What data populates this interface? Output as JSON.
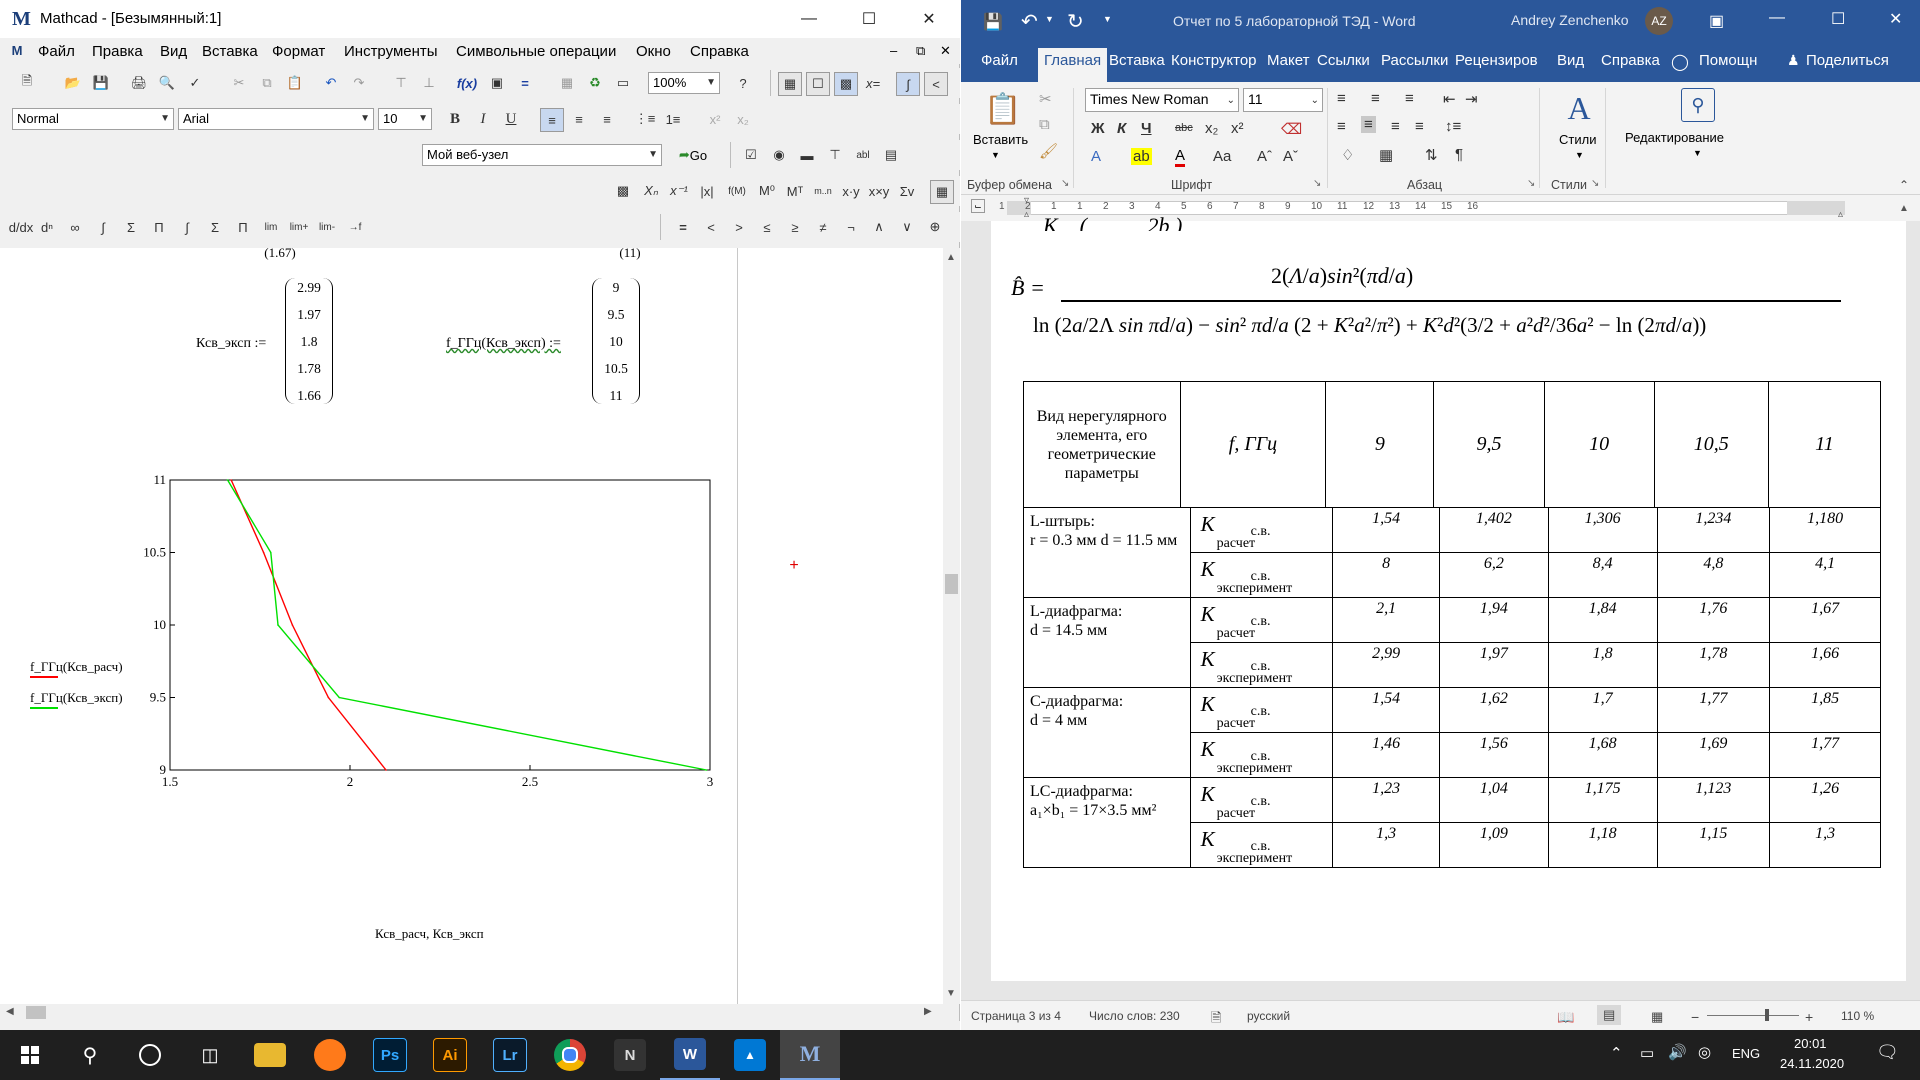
{
  "mathcad": {
    "title": "Mathcad - [Безымянный:1]",
    "menu": [
      "Файл",
      "Правка",
      "Вид",
      "Вставка",
      "Формат",
      "Инструменты",
      "Символьные операции",
      "Окно",
      "Справка"
    ],
    "zoom": "100%",
    "style_combo": "Normal",
    "font_combo": "Arial",
    "size_combo": "10",
    "url_combo": "Мой веб-узел",
    "go_label": "Go",
    "partial_top_left": "1.67",
    "partial_top_right": "11",
    "left_def_label": "Ксв_эксп :=",
    "right_def_label": "f_ГГц(Ксв_эксп) :=",
    "left_matrix": [
      "2.99",
      "1.97",
      "1.8",
      "1.78",
      "1.66"
    ],
    "right_matrix": [
      "9",
      "9.5",
      "10",
      "10.5",
      "11"
    ],
    "legend": [
      {
        "label": "f_ГГц(Ксв_расч)",
        "color": "#ff0000"
      },
      {
        "label": "f_ГГц(Ксв_эксп)",
        "color": "#00e000"
      }
    ],
    "x_axis_label": "Ксв_расч, Ксв_эксп"
  },
  "chart_data": {
    "type": "line",
    "title": "",
    "xlabel": "Ксв_расч, Ксв_эксп",
    "ylabel": "",
    "xlim": [
      1.5,
      3
    ],
    "ylim": [
      9,
      11
    ],
    "x_ticks": [
      "1.5",
      "2",
      "2.5",
      "3"
    ],
    "y_ticks": [
      "9",
      "9.5",
      "10",
      "10.5",
      "11"
    ],
    "series": [
      {
        "name": "f_ГГц(Ксв_расч)",
        "color": "#ff0000",
        "x": [
          2.1,
          1.94,
          1.84,
          1.76,
          1.67
        ],
        "y": [
          9,
          9.5,
          10,
          10.5,
          11
        ]
      },
      {
        "name": "f_ГГц(Ксв_эксп)",
        "color": "#00e000",
        "x": [
          2.99,
          1.97,
          1.8,
          1.78,
          1.66
        ],
        "y": [
          9,
          9.5,
          10,
          10.5,
          11
        ]
      }
    ]
  },
  "word": {
    "title": "Отчет по 5 лабораторной ТЭД - Word",
    "user": "Andrey Zenchenko",
    "tabs": [
      "Файл",
      "Главная",
      "Вставка",
      "Конструктор",
      "Макет",
      "Ссылки",
      "Рассылки",
      "Рецензиров",
      "Вид",
      "Справка",
      "Помощн",
      "Поделиться"
    ],
    "font_name": "Times New Roman",
    "font_size": "11",
    "paste_label": "Вставить",
    "styles_label": "Стили",
    "editing_label": "Редактирование",
    "groups": [
      "Буфер обмена",
      "Шрифт",
      "Абзац",
      "Стили"
    ],
    "ruler_numbers": [
      "1",
      "2",
      "1",
      "1",
      "2",
      "3",
      "4",
      "5",
      "6",
      "7",
      "8",
      "9",
      "10",
      "11",
      "12",
      "13",
      "14",
      "15",
      "16"
    ],
    "table": {
      "header": [
        "Вид нерегулярного элемента, его геометрические параметры",
        "f, ГГц",
        "9",
        "9,5",
        "10",
        "10,5",
        "11"
      ],
      "row_sub_calc": "с.в.",
      "row_calc_label": "расчет",
      "row_exp_label": "эксперимент",
      "elements": [
        {
          "name": "L-штырь:",
          "params": "r = 0.3 мм d = 11.5 мм",
          "calc": [
            "1,54",
            "1,402",
            "1,306",
            "1,234",
            "1,180"
          ],
          "exp": [
            "8",
            "6,2",
            "8,4",
            "4,8",
            "4,1"
          ]
        },
        {
          "name": "L-диафрагма:",
          "params": "d = 14.5 мм",
          "calc": [
            "2,1",
            "1,94",
            "1,84",
            "1,76",
            "1,67"
          ],
          "exp": [
            "2,99",
            "1,97",
            "1,8",
            "1,78",
            "1,66"
          ]
        },
        {
          "name": "С-диафрагма:",
          "params": "d = 4 мм",
          "calc": [
            "1,54",
            "1,62",
            "1,7",
            "1,77",
            "1,85"
          ],
          "exp": [
            "1,46",
            "1,56",
            "1,68",
            "1,69",
            "1,77"
          ]
        },
        {
          "name": "LC-диафрагма:",
          "params": "a₁×b₁ = 17×3.5 мм²",
          "calc": [
            "1,23",
            "1,04",
            "1,175",
            "1,123",
            "1,26"
          ],
          "exp": [
            "1,3",
            "1,09",
            "1,18",
            "1,15",
            "1,3"
          ]
        }
      ]
    },
    "status": {
      "page": "Страница 3 из 4",
      "words": "Число слов: 230",
      "lang": "русский",
      "zoom": "110 %"
    }
  },
  "taskbar": {
    "lang": "ENG",
    "time": "20:01",
    "date": "24.11.2020",
    "apps": [
      "Ps",
      "Ai",
      "Lr",
      "Chrome",
      "N",
      "W",
      "Photos",
      "M"
    ]
  }
}
